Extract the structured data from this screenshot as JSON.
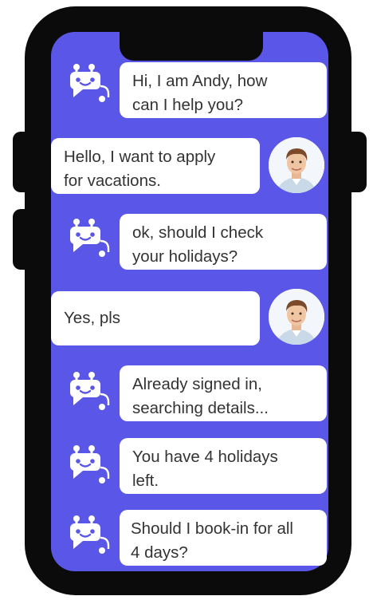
{
  "messages": [
    {
      "sender": "bot",
      "lines": [
        "Hi, I am Andy, how",
        "can I help you?"
      ]
    },
    {
      "sender": "user",
      "lines": [
        "Hello, I want to apply",
        "for vacations."
      ]
    },
    {
      "sender": "bot",
      "lines": [
        "ok, should I check",
        "your holidays?"
      ]
    },
    {
      "sender": "user",
      "lines": [
        "Yes, pls"
      ]
    },
    {
      "sender": "bot",
      "lines": [
        "Already signed in,",
        "searching details..."
      ]
    },
    {
      "sender": "bot",
      "lines": [
        "You have 4 holidays",
        "left."
      ]
    },
    {
      "sender": "bot",
      "lines": [
        "Should I book-in for all",
        "4 days?"
      ]
    }
  ],
  "icons": {
    "bot": "chatbot-icon",
    "user": "user-avatar"
  },
  "colors": {
    "screen": "#5a56e8",
    "frame": "#0b0b0b",
    "bubble": "#ffffff",
    "text": "#333333",
    "bot_icon": "#ffffff"
  }
}
